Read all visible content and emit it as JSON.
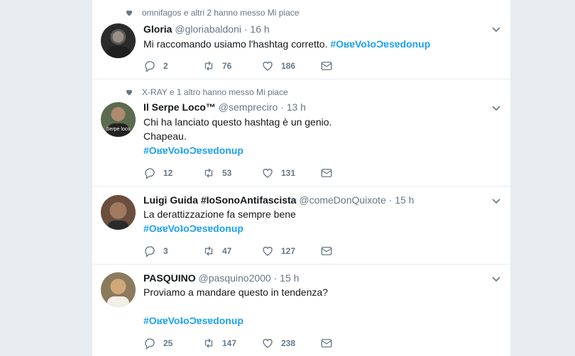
{
  "tweets": [
    {
      "context": "omnifagos e altri 2 hanno messo Mi piace",
      "name": "Gloria",
      "handle": "@gloriabaldoni",
      "dot": "·",
      "time": "16 h",
      "lines": [
        "Mi raccomando usiamo l'hashtag corretto."
      ],
      "hashtag": "#OʁɐVoʇoƆɐsɐdonup",
      "replies": "2",
      "retweets": "76",
      "likes": "186",
      "avatar_color": "#2b2b2b"
    },
    {
      "context": "X-RAY e 1 altro hanno messo Mi piace",
      "name": "Il Serpe Loco™",
      "handle": "@sempreciro",
      "dot": "·",
      "time": "13 h",
      "lines": [
        "Chi ha lanciato questo hashtag è un genio.",
        "Chapeau."
      ],
      "hashtag": "#OʁɐVoʇoƆɐsɐdonup",
      "avatar_label": "Serpe loco",
      "replies": "12",
      "retweets": "53",
      "likes": "131",
      "avatar_color": "#5a6b4f"
    },
    {
      "name": "Luigi Guida #IoSonoAntifascista",
      "handle": "@comeDonQuixote",
      "dot": "·",
      "time": "15 h",
      "lines": [
        "La derattizzazione fa sempre bene"
      ],
      "hashtag": "#OʁɐVoʇoƆɐsɐdonup",
      "replies": "3",
      "retweets": "47",
      "likes": "127",
      "avatar_color": "#6b4e3d"
    },
    {
      "name": "PASQUINO",
      "handle": "@pasquino2000",
      "dot": "·",
      "time": "15 h",
      "lines": [
        "Proviamo a mandare questo in tendenza?"
      ],
      "hashtag": "#OʁɐVoʇoƆɐsɐdonup",
      "replies": "25",
      "retweets": "147",
      "likes": "238",
      "avatar_color": "#8a7a5e"
    }
  ],
  "colors": {
    "accent": "#1da1f2",
    "secondary_text": "#657786",
    "background": "#e6ecf0"
  }
}
